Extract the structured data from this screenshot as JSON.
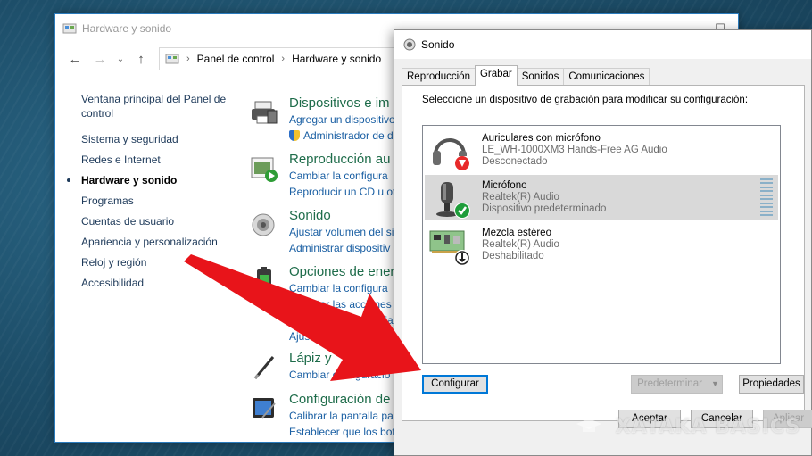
{
  "control_panel": {
    "window_title": "Hardware y sonido",
    "breadcrumb": [
      "Panel de control",
      "Hardware y sonido"
    ],
    "sidebar": [
      {
        "label": "Ventana principal del Panel de control"
      },
      {
        "label": "Sistema y seguridad"
      },
      {
        "label": "Redes e Internet"
      },
      {
        "label": "Hardware y sonido",
        "current": true
      },
      {
        "label": "Programas"
      },
      {
        "label": "Cuentas de usuario"
      },
      {
        "label": "Apariencia y personalización"
      },
      {
        "label": "Reloj y región"
      },
      {
        "label": "Accesibilidad"
      }
    ],
    "categories": [
      {
        "title": "Dispositivos e im",
        "links": [
          "Agregar un dispositivo",
          "Administrador de d"
        ],
        "icon": "printer-icon"
      },
      {
        "title": "Reproducción au",
        "links": [
          "Cambiar la configura",
          "Reproducir un CD u ot"
        ],
        "icon": "autoplay-icon"
      },
      {
        "title": "Sonido",
        "links": [
          "Ajustar volumen del sis",
          "Administrar dispositiv"
        ],
        "icon": "speaker-icon"
      },
      {
        "title": "Opciones de ener",
        "links": [
          "Cambiar la configura",
          "Cambiar las acciones d",
          "Cambiar la frecuencia",
          "Ajusta"
        ],
        "icon": "battery-icon"
      },
      {
        "title": "Lápiz y",
        "links": [
          "Cambiar configuracio"
        ],
        "icon": "pen-icon"
      },
      {
        "title": "Configuración de",
        "links": [
          "Calibrar la pantalla para",
          "Establecer que los botones del Tablet PC sirvan diferentes tareas"
        ],
        "icon": "tablet-icon"
      }
    ]
  },
  "sound_dialog": {
    "title": "Sonido",
    "tabs": [
      {
        "label": "Reproducción"
      },
      {
        "label": "Grabar",
        "active": true
      },
      {
        "label": "Sonidos"
      },
      {
        "label": "Comunicaciones"
      }
    ],
    "instructions": "Seleccione un dispositivo de grabación para modificar su configuración:",
    "devices": [
      {
        "name": "Auriculares con micrófono",
        "driver": "LE_WH-1000XM3 Hands-Free AG Audio",
        "status": "Desconectado",
        "icon": "headset-icon",
        "badge": "red-down-arrow-icon"
      },
      {
        "name": "Micrófono",
        "driver": "Realtek(R) Audio",
        "status": "Dispositivo predeterminado",
        "icon": "microphone-icon",
        "badge": "green-check-icon",
        "selected": true
      },
      {
        "name": "Mezcla estéreo",
        "driver": "Realtek(R) Audio",
        "status": "Deshabilitado",
        "icon": "sound-card-icon",
        "badge": "black-down-arrow-icon"
      }
    ],
    "buttons": {
      "configure": "Configurar",
      "set_default": "Predeterminar",
      "properties": "Propiedades",
      "accept": "Aceptar",
      "cancel": "Cancelar",
      "apply": "Aplicar"
    }
  },
  "watermark": "XATAKA BASICS",
  "colors": {
    "link_blue": "#1a5fa3",
    "category_green": "#1e6c4a",
    "selection_gray": "#d9d9d9",
    "focus_blue": "#0078d7",
    "arrow_red": "#e8141a"
  }
}
